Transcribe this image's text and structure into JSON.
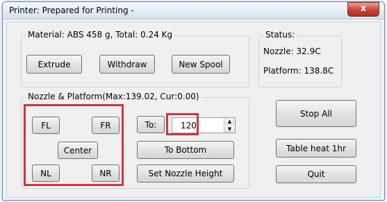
{
  "window": {
    "title": "Printer: Prepared for Printing -",
    "close_glyph": "x"
  },
  "material_group": {
    "title": "Material: ABS 458 g,  Total: 0.24 Kg",
    "extrude_label": "Extrude",
    "withdraw_label": "Withdraw",
    "new_spool_label": "New Spool"
  },
  "status_group": {
    "title": "Status:",
    "nozzle": "Nozzle: 32.9C",
    "platform": "Platform: 138.8C"
  },
  "nozzle_group": {
    "title": "Nozzle & Platform(Max:139.02, Cur:0.00)",
    "fl_label": "FL",
    "fr_label": "FR",
    "center_label": "Center",
    "nl_label": "NL",
    "nr_label": "NR",
    "to_label": "To:",
    "to_value": "120",
    "to_bottom_label": "To Bottom",
    "set_nozzle_height_label": "Set Nozzle Height"
  },
  "actions": {
    "stop_all_label": "Stop All",
    "table_heat_label": "Table heat 1hr",
    "quit_label": "Quit"
  },
  "colors": {
    "highlight": "#d0353b",
    "close_button": "#c54334"
  }
}
